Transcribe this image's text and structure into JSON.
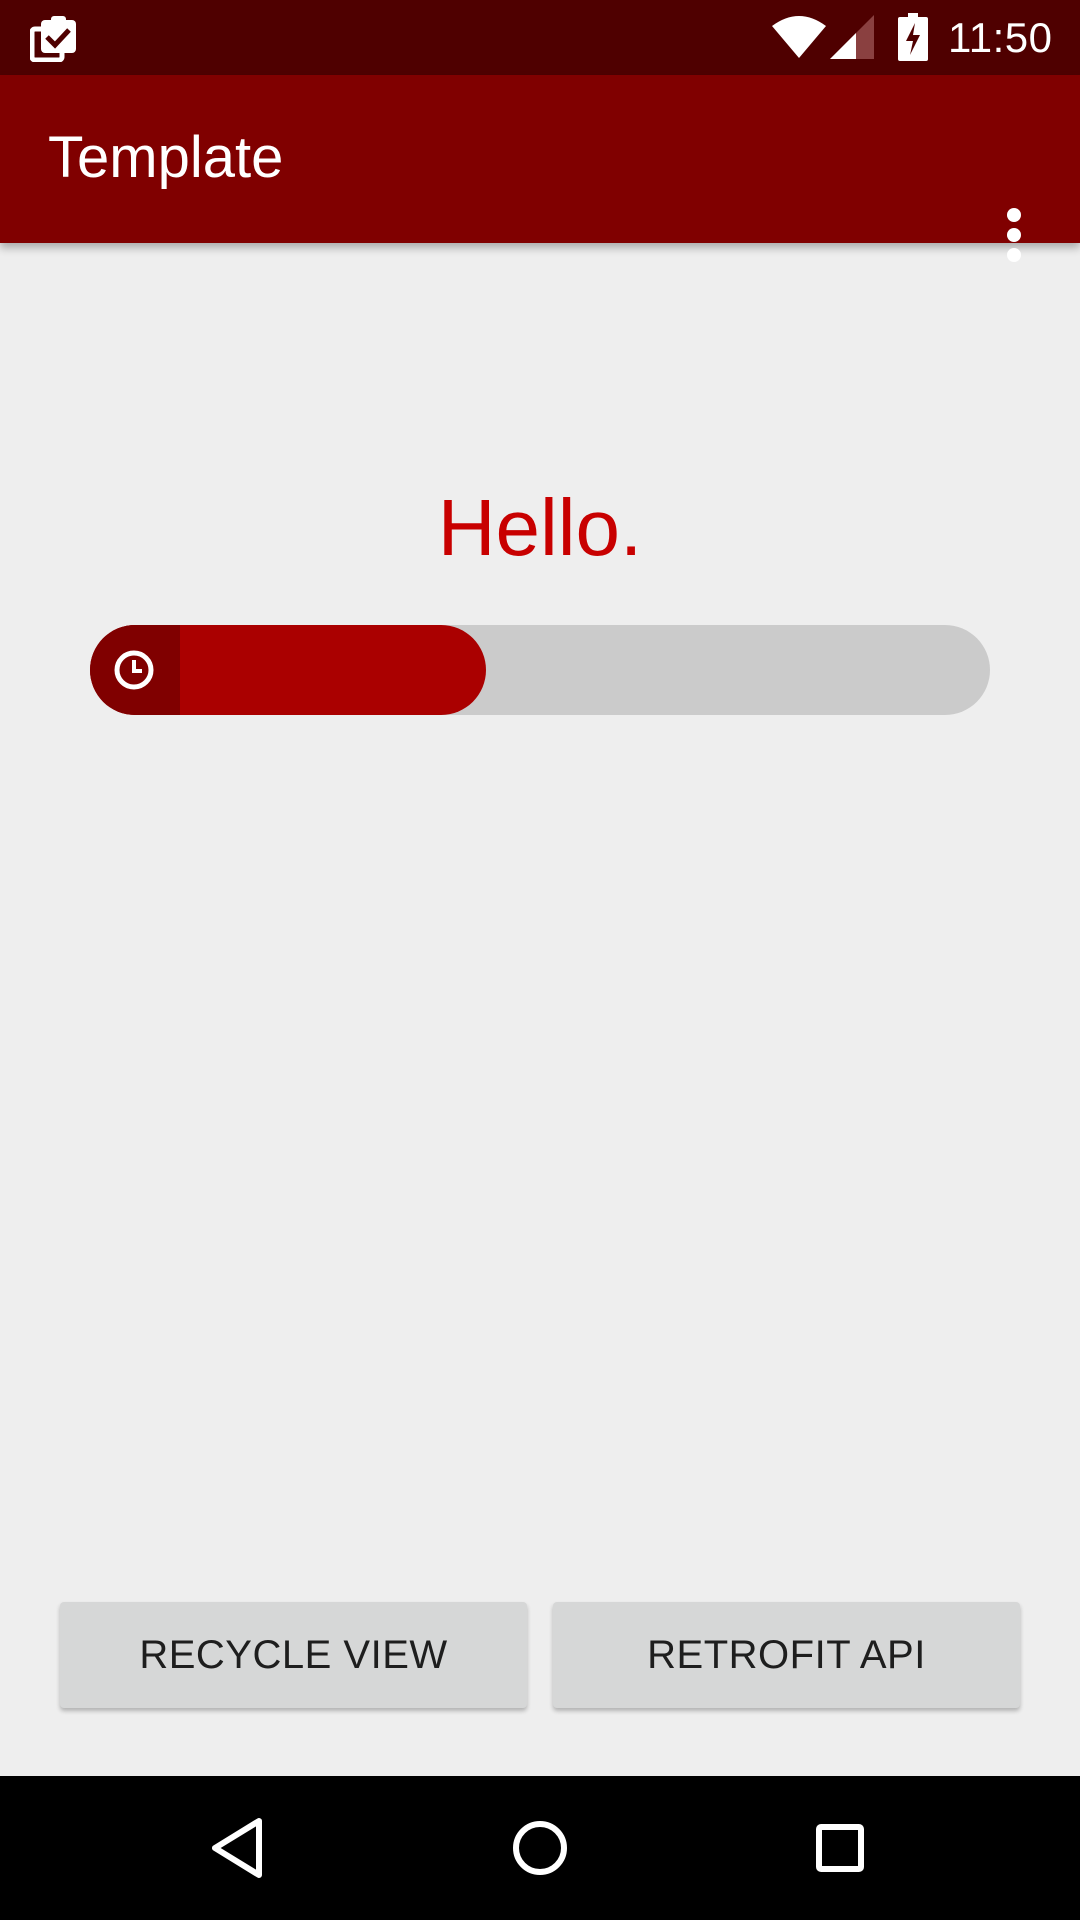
{
  "status_bar": {
    "time": "11:50",
    "icons": [
      "task-clipboard-icon",
      "wifi-icon",
      "cell-signal-icon",
      "battery-charging-icon"
    ],
    "background_color": "#4f0000"
  },
  "app_bar": {
    "title": "Template",
    "overflow_icon": "more-vert-icon",
    "background_color": "#800000"
  },
  "main": {
    "greeting": "Hello.",
    "greeting_color": "#c80000",
    "progress": {
      "icon": "clock-icon",
      "fill_fraction": 0.44,
      "fill_color": "#aa0000",
      "track_color": "#cbcbcb"
    }
  },
  "buttons": {
    "recycle_view_label": "RECYCLE VIEW",
    "retrofit_api_label": "RETROFIT API"
  },
  "nav_bar": {
    "icons": [
      "back-icon",
      "home-icon",
      "recents-icon"
    ]
  }
}
